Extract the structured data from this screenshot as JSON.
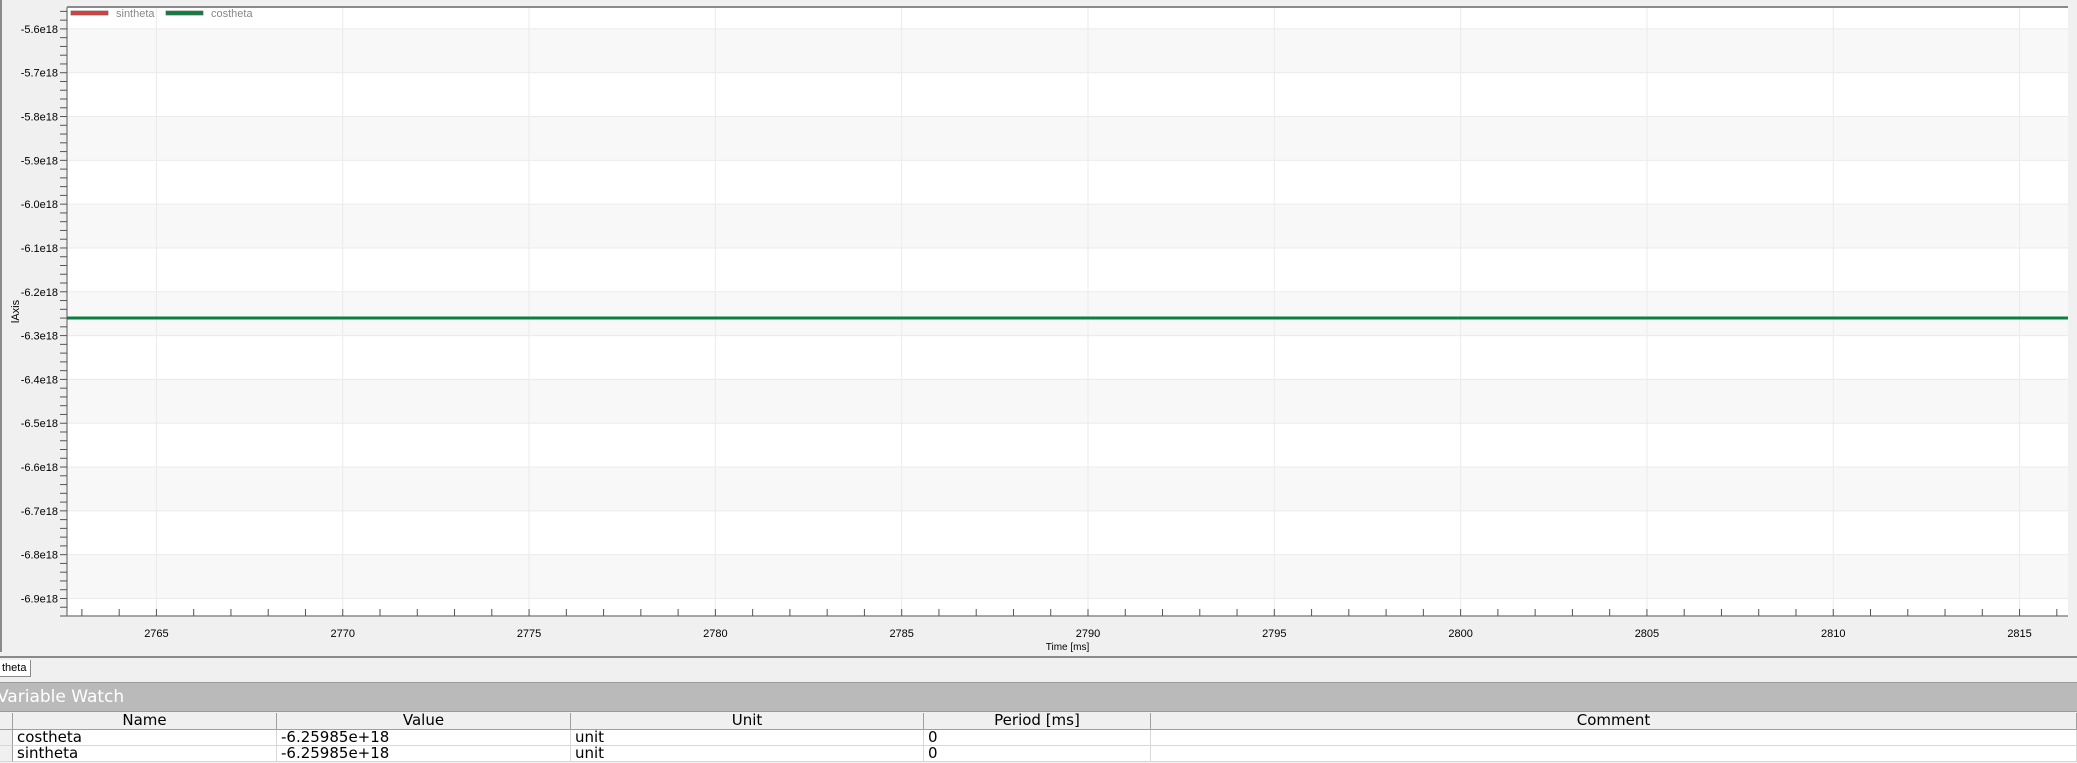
{
  "chart_data": {
    "type": "line",
    "title": "",
    "xlabel": "Time [ms]",
    "ylabel": "lAxis",
    "xlim": [
      2762.6,
      2816.3
    ],
    "ylim": [
      -6.94e+18,
      -5.55e+18
    ],
    "x_ticks": [
      2765,
      2770,
      2775,
      2780,
      2785,
      2790,
      2795,
      2800,
      2805,
      2810,
      2815
    ],
    "x_tick_labels": [
      "2765",
      "2770",
      "2775",
      "2780",
      "2785",
      "2790",
      "2795",
      "2800",
      "2805",
      "2810",
      "2815"
    ],
    "y_ticks": [
      -5.6e+18,
      -5.7e+18,
      -5.8e+18,
      -5.9e+18,
      -6e+18,
      -6.1e+18,
      -6.2e+18,
      -6.3e+18,
      -6.4e+18,
      -6.5e+18,
      -6.6e+18,
      -6.7e+18,
      -6.8e+18,
      -6.9e+18
    ],
    "y_tick_labels": [
      "-5.6e18",
      "-5.7e18",
      "-5.8e18",
      "-5.9e18",
      "-6.0e18",
      "-6.1e18",
      "-6.2e18",
      "-6.3e18",
      "-6.4e18",
      "-6.5e18",
      "-6.6e18",
      "-6.7e18",
      "-6.8e18",
      "-6.9e18"
    ],
    "grid": true,
    "legend_position": "top-left",
    "series": [
      {
        "name": "sintheta",
        "color": "#e03c3c",
        "x": [
          2762.6,
          2816.3
        ],
        "y": [
          -6.25985e+18,
          -6.25985e+18
        ]
      },
      {
        "name": "costheta",
        "color": "#0a8040",
        "x": [
          2762.6,
          2816.3
        ],
        "y": [
          -6.25985e+18,
          -6.25985e+18
        ]
      }
    ]
  },
  "tabs": [
    {
      "label": "theta"
    }
  ],
  "variable_watch": {
    "title": "Variable Watch",
    "columns": [
      "Name",
      "Value",
      "Unit",
      "Period [ms]",
      "Comment"
    ],
    "rows": [
      {
        "name": "costheta",
        "value": "-6.25985e+18",
        "unit": "unit",
        "period": "0",
        "comment": ""
      },
      {
        "name": "sintheta",
        "value": "-6.25985e+18",
        "unit": "unit",
        "period": "0",
        "comment": ""
      }
    ]
  }
}
